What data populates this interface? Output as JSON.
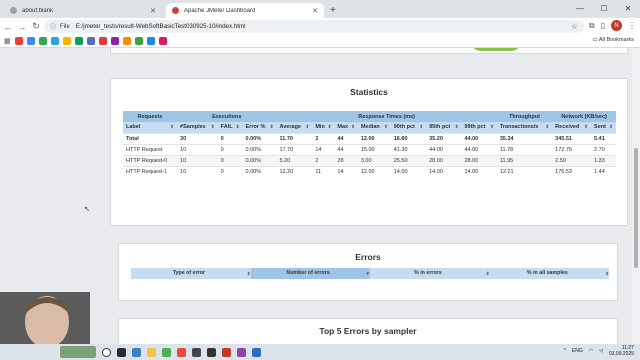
{
  "browser": {
    "tabs": [
      {
        "title": "about:blank",
        "active": false
      },
      {
        "title": "Apache JMeter Dashboard",
        "active": true
      }
    ],
    "omnibox_label": "File",
    "url": "E:/jmeter_tests/result-WebSoftBasicTest030925-10/index.html",
    "all_bookmarks": "All Bookmarks",
    "profile_initial": "N"
  },
  "statistics": {
    "title": "Statistics",
    "groups": [
      "Requests",
      "Executions",
      "Response Times (ms)",
      "Throughput",
      "Network (KB/sec)"
    ],
    "columns": [
      "Label",
      "#Samples",
      "FAIL",
      "Error %",
      "Average",
      "Min",
      "Max",
      "Median",
      "90th pct",
      "95th pct",
      "99th pct",
      "Transactions/s",
      "Received",
      "Sent"
    ],
    "rows": [
      [
        "Total",
        "30",
        "0",
        "0.00%",
        "11.70",
        "2",
        "44",
        "12.00",
        "16.80",
        "35.20",
        "44.00",
        "35.34",
        "345.51",
        "5.41"
      ],
      [
        "HTTP Request",
        "10",
        "0",
        "0.00%",
        "17.70",
        "14",
        "44",
        "15.00",
        "41.30",
        "44.00",
        "44.00",
        "11.78",
        "172.76",
        "2.70"
      ],
      [
        "HTTP Request-0",
        "10",
        "0",
        "0.00%",
        "5.20",
        "2",
        "28",
        "3.00",
        "25.50",
        "28.00",
        "28.00",
        "11.95",
        "2.50",
        "1.33"
      ],
      [
        "HTTP Request-1",
        "10",
        "0",
        "0.00%",
        "12.20",
        "11",
        "14",
        "12.00",
        "14.00",
        "14.00",
        "14.00",
        "12.21",
        "176.53",
        "1.44"
      ]
    ]
  },
  "errors": {
    "title": "Errors",
    "columns": [
      "Type of error",
      "Number of errors",
      "% in errors",
      "% in all samples"
    ]
  },
  "top5": {
    "title": "Top 5 Errors by sampler"
  },
  "taskbar": {
    "lang": "ENG",
    "time": "11:27",
    "date": "03.09.2025"
  }
}
